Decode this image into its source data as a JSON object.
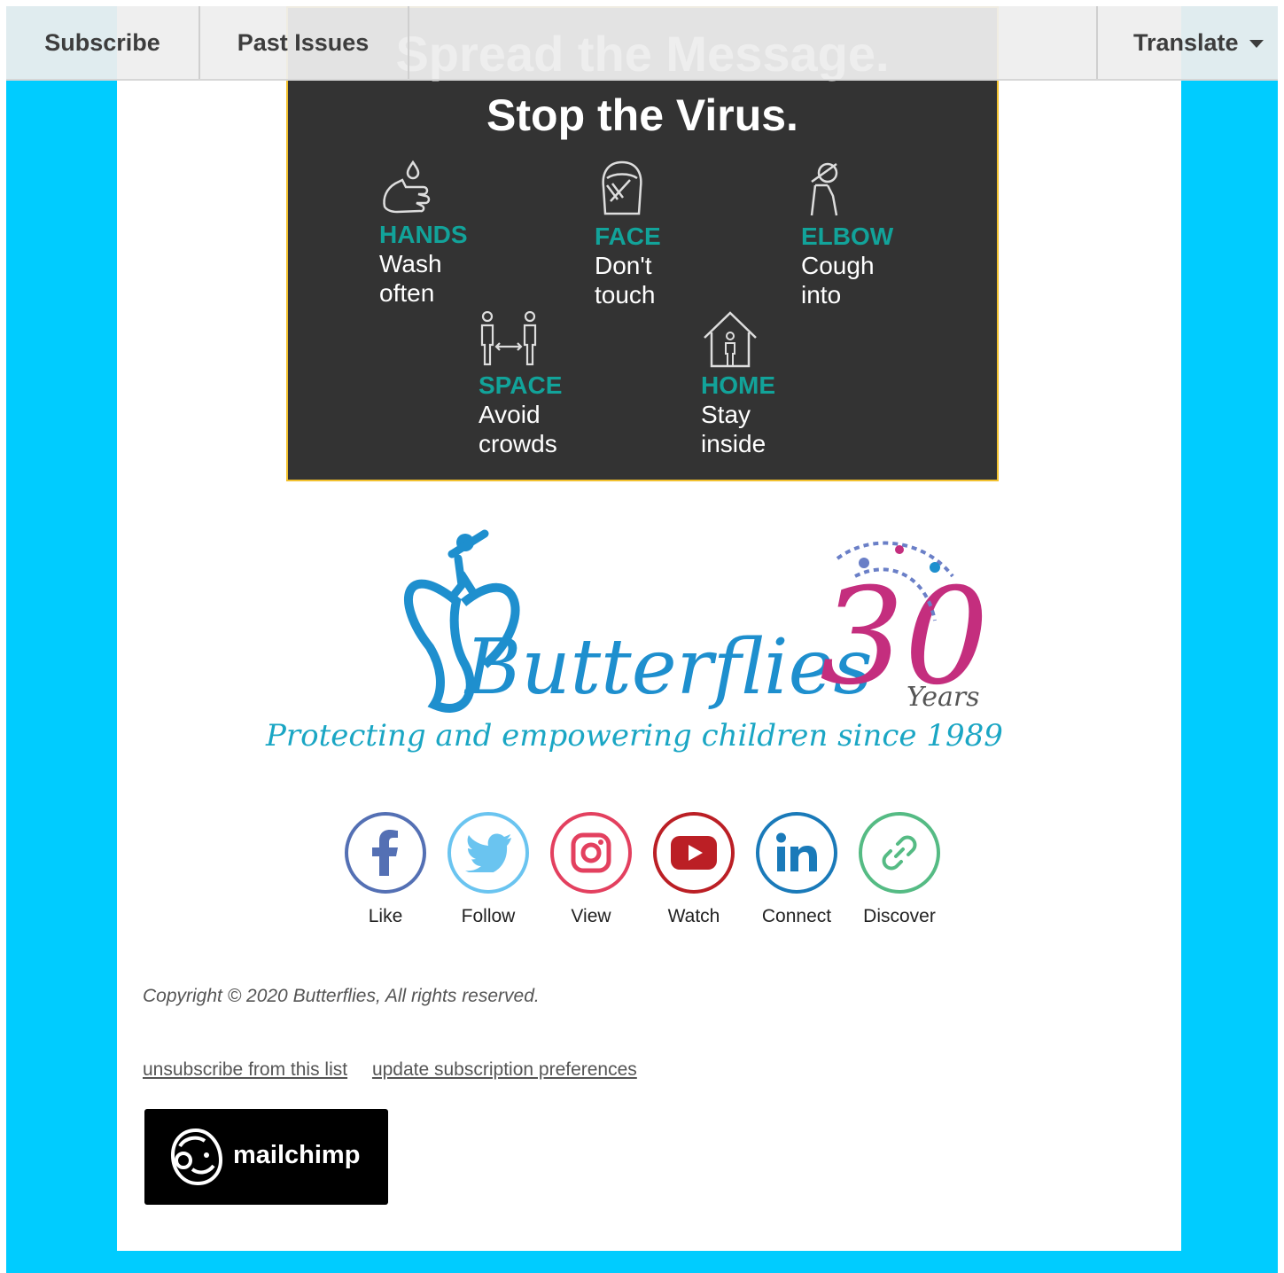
{
  "nav": {
    "subscribe": "Subscribe",
    "past_issues": "Past Issues",
    "translate": "Translate"
  },
  "poster": {
    "header_text": "Spread the Message.",
    "title": "Stop the Virus.",
    "tips": [
      {
        "key": "HANDS",
        "value": "Wash\noften",
        "icon": "hand-wash-icon"
      },
      {
        "key": "FACE",
        "value": "Don't\ntouch",
        "icon": "face-icon"
      },
      {
        "key": "ELBOW",
        "value": "Cough\ninto",
        "icon": "elbow-cough-icon"
      },
      {
        "key": "SPACE",
        "value": "Avoid\ncrowds",
        "icon": "social-distance-icon"
      },
      {
        "key": "HOME",
        "value": "Stay\ninside",
        "icon": "house-icon"
      }
    ]
  },
  "logo": {
    "name": "Butterflies",
    "anniversary": "30",
    "years": "Years",
    "tagline": "Protecting and empowering children since 1989"
  },
  "social": [
    {
      "label": "Like",
      "icon": "facebook-icon",
      "color": "#5470b4"
    },
    {
      "label": "Follow",
      "icon": "twitter-icon",
      "color": "#6ac4f0"
    },
    {
      "label": "View",
      "icon": "instagram-icon",
      "color": "#e3405f"
    },
    {
      "label": "Watch",
      "icon": "youtube-icon",
      "color": "#bb1f25"
    },
    {
      "label": "Connect",
      "icon": "linkedin-icon",
      "color": "#1a7ab9"
    },
    {
      "label": "Discover",
      "icon": "link-icon",
      "color": "#55bb84"
    }
  ],
  "footer": {
    "copyright": "Copyright © 2020 Butterflies, All rights reserved.",
    "unsubscribe": "unsubscribe from this list",
    "update_prefs": "update subscription preferences",
    "badge_text": "mailchimp"
  },
  "colors": {
    "background": "#00ccff",
    "accent_teal": "#12a39a",
    "poster_bg": "#333333"
  }
}
